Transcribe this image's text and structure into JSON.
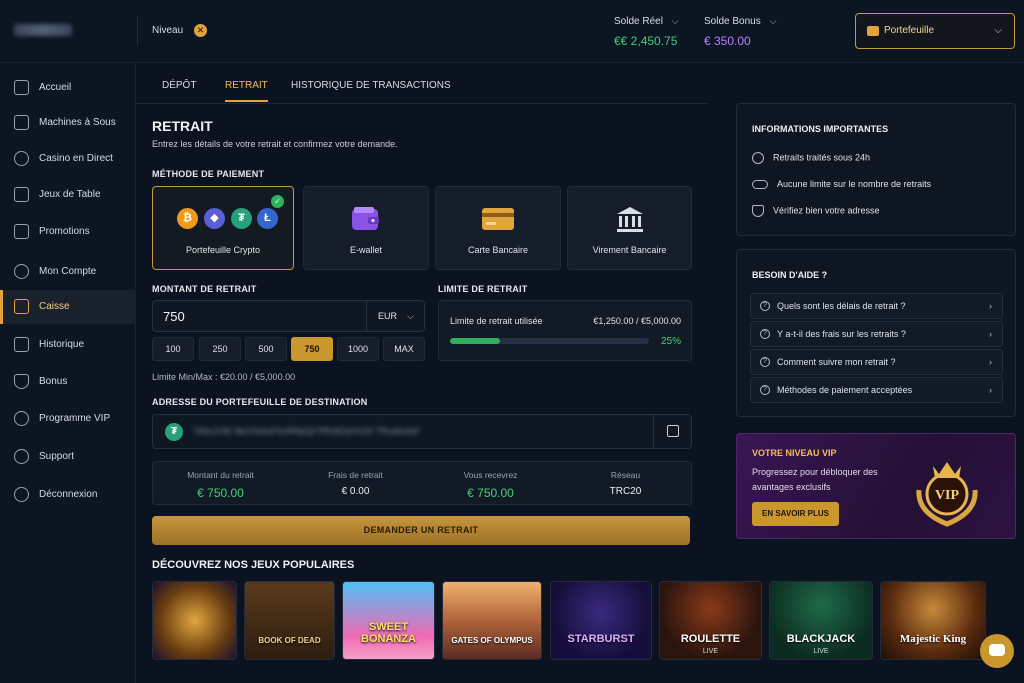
{
  "header": {
    "niveau_label": "Niveau",
    "niveau_badge": "✕",
    "solde_reel_label": "Solde Réel",
    "solde_reel_value": "€€ 2,450.75",
    "solde_bonus_label": "Solde Bonus",
    "solde_bonus_value": "€ 350.00",
    "wallet_label": "Portefeuille"
  },
  "sidebar": {
    "items": [
      {
        "label": "Accueil",
        "icon": "home-icon"
      },
      {
        "label": "Machines à Sous",
        "icon": "slots-icon"
      },
      {
        "label": "Casino en Direct",
        "icon": "live-casino-icon"
      },
      {
        "label": "Jeux de Table",
        "icon": "table-games-icon"
      },
      {
        "label": "Promotions",
        "icon": "gift-icon"
      },
      {
        "label": "Mon Compte",
        "icon": "user-icon"
      },
      {
        "label": "Caisse",
        "icon": "wallet-icon"
      },
      {
        "label": "Historique",
        "icon": "history-icon"
      },
      {
        "label": "Bonus",
        "icon": "bonus-icon"
      },
      {
        "label": "Programme VIP",
        "icon": "crown-icon"
      },
      {
        "label": "Support",
        "icon": "support-icon"
      },
      {
        "label": "Déconnexion",
        "icon": "logout-icon"
      }
    ]
  },
  "tabs": [
    "DÉPÔT",
    "RETRAIT",
    "HISTORIQUE DE TRANSACTIONS"
  ],
  "retrait": {
    "title": "RETRAIT",
    "subtitle": "Entrez les détails de votre retrait et confirmez votre demande.",
    "method_label": "MÉTHODE DE PAIEMENT",
    "methods": [
      "Portefeuille Crypto",
      "E-wallet",
      "Carte Bancaire",
      "Virement Bancaire"
    ],
    "amount_label": "MONTANT DE RETRAIT",
    "amount_value": "750",
    "currency": "EUR",
    "quick_amounts": [
      "100",
      "250",
      "500",
      "750",
      "1000",
      "MAX"
    ],
    "limit_note": "Limite Min/Max : €20.00 / €5,000.00",
    "limit_label": "LIMITE DE RETRAIT",
    "limit_used_label": "Limite de retrait utilisée",
    "limit_used_value": "€1,250.00 / €5,000.00",
    "limit_pct_text": "25%",
    "limit_fraction": 0.25,
    "address_label": "ADRESSE DU PORTEFEUILLE DE DESTINATION",
    "address_value": "TAbc1r9d 3kmXe4uFkvW9pQz7tRnB2yHcS4 TRxabcdef",
    "summary": [
      {
        "k": "Montant du retrait",
        "v": "€ 750.00"
      },
      {
        "k": "Frais de retrait",
        "v": "€ 0.00"
      },
      {
        "k": "Vous recevrez",
        "v": "€ 750.00"
      },
      {
        "k": "Réseau",
        "v": "TRC20"
      }
    ],
    "cta": "DEMANDER UN RETRAIT"
  },
  "games": {
    "title": "DÉCOUVREZ NOS JEUX POPULAIRES",
    "items": [
      {
        "t": "",
        "s": ""
      },
      {
        "t": "BOOK OF DEAD",
        "s": ""
      },
      {
        "t": "SWEET BONANZA",
        "s": ""
      },
      {
        "t": "GATES OF OLYMPUS",
        "s": ""
      },
      {
        "t": "STARBURST",
        "s": ""
      },
      {
        "t": "ROULETTE",
        "s": "LIVE"
      },
      {
        "t": "BLACKJACK",
        "s": "LIVE"
      },
      {
        "t": "Majestic King",
        "s": ""
      }
    ]
  },
  "info": {
    "title": "INFORMATIONS IMPORTANTES",
    "items": [
      "Retraits traités sous 24h",
      "Aucune limite sur le nombre de retraits",
      "Vérifiez bien votre adresse"
    ]
  },
  "help": {
    "title": "BESOIN D'AIDE ?",
    "faqs": [
      "Quels sont les délais de retrait ?",
      "Y a-t-il des frais sur les retraits ?",
      "Comment suivre mon retrait ?",
      "Méthodes de paiement acceptées"
    ]
  },
  "vip": {
    "title": "VOTRE NIVEAU VIP",
    "desc": "Progressez pour débloquer des avantages exclusifs",
    "button": "EN SAVOIR PLUS",
    "badge_text": "VIP"
  },
  "colors": {
    "accent": "#e2a33a",
    "green": "#3fd27a",
    "purple": "#b980ff",
    "bg": "#0b1320"
  }
}
